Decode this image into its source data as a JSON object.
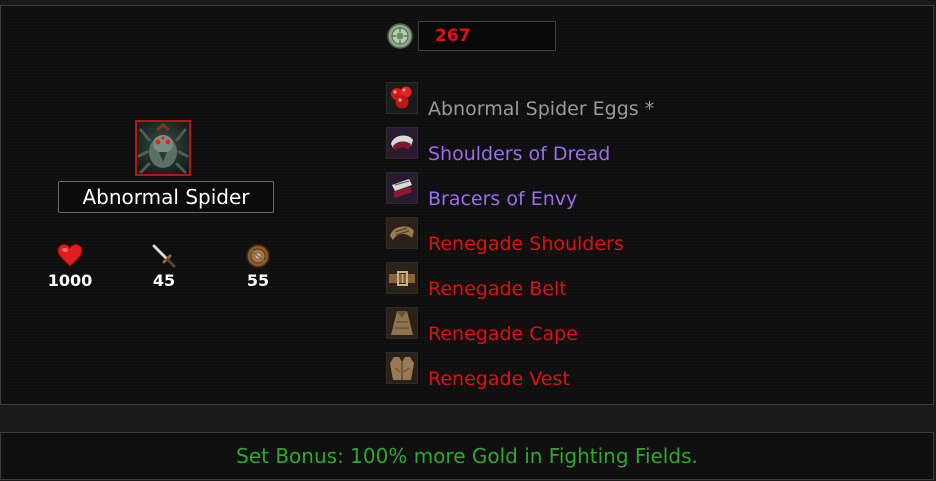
{
  "currency": {
    "icon": "coin-icon",
    "amount": "267",
    "amount_color": "#e01010"
  },
  "monster": {
    "name": "Abnormal Spider",
    "portrait": "spider-portrait",
    "portrait_border_color": "#b81515",
    "stats": [
      {
        "icon": "heart-icon",
        "value": "1000"
      },
      {
        "icon": "sword-icon",
        "value": "45"
      },
      {
        "icon": "shield-icon",
        "value": "55"
      }
    ]
  },
  "items": [
    {
      "name": "Abnormal Spider Eggs *",
      "icon": "spider-eggs-icon",
      "color": "#9a9a9a"
    },
    {
      "name": "Shoulders of Dread",
      "icon": "shoulders-icon",
      "color": "#9b6cf0"
    },
    {
      "name": "Bracers of Envy",
      "icon": "bracers-icon",
      "color": "#9b6cf0"
    },
    {
      "name": "Renegade Shoulders",
      "icon": "leather-shoulders-icon",
      "color": "#e01010"
    },
    {
      "name": "Renegade Belt",
      "icon": "belt-icon",
      "color": "#e01010"
    },
    {
      "name": "Renegade Cape",
      "icon": "cape-icon",
      "color": "#e01010"
    },
    {
      "name": "Renegade Vest",
      "icon": "vest-icon",
      "color": "#e01010"
    }
  ],
  "set_bonus": {
    "text": "Set Bonus: 100% more Gold in Fighting Fields.",
    "color": "#2fa72f"
  }
}
